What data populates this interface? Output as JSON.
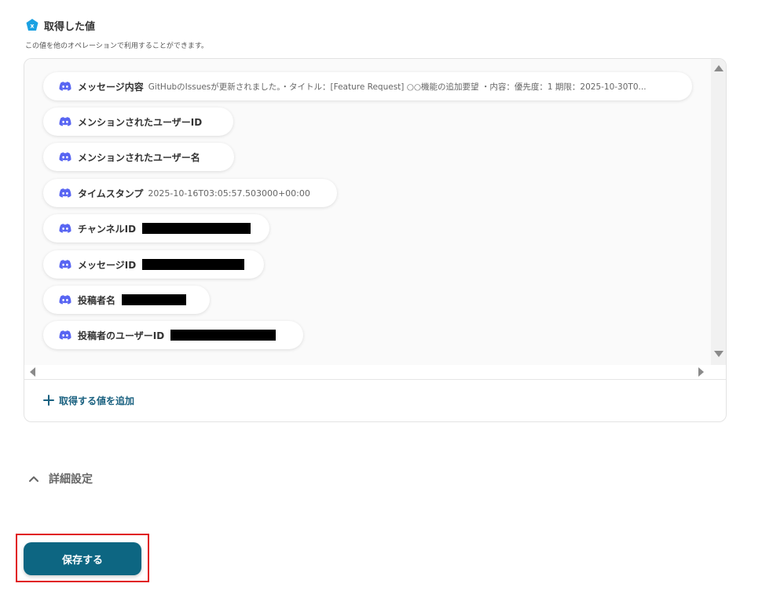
{
  "section": {
    "title": "取得した値",
    "description": "この値を他のオペレーションで利用することができます。"
  },
  "items": [
    {
      "label": "メッセージ内容",
      "value": "GitHubのIssuesが更新されました。・タイトル：[Feature Request] ○○機能の追加要望 ・内容：優先度：1 期限：2025-10-30T0..."
    },
    {
      "label": "メンションされたユーザーID",
      "value": ""
    },
    {
      "label": "メンションされたユーザー名",
      "value": ""
    },
    {
      "label": "タイムスタンプ",
      "value": "2025-10-16T03:05:57.503000+00:00"
    },
    {
      "label": "チャンネルID",
      "value": ""
    },
    {
      "label": "メッセージID",
      "value": ""
    },
    {
      "label": "投稿者名",
      "value": ""
    },
    {
      "label": "投稿者のユーザーID",
      "value": ""
    }
  ],
  "add_value_label": "取得する値を追加",
  "advanced_settings_label": "詳細設定",
  "save_button_label": "保存する",
  "colors": {
    "accent": "#0d6682",
    "link": "#1a6180",
    "discord": "#5865F2",
    "highlight_border": "#e0161b",
    "section_icon": "#1ba1e2"
  },
  "icons": {
    "section": "variable-icon",
    "item": "discord-icon",
    "add": "plus-icon",
    "toggle": "chevron-up-icon"
  }
}
